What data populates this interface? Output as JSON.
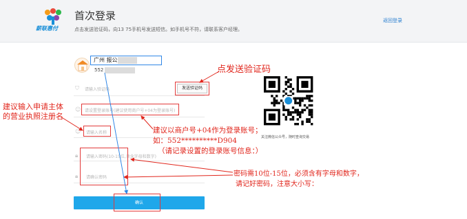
{
  "header": {
    "title": "首次登录",
    "subtitle": "点击发送验证码，向13        75手机号发送短信。如手机号不符，请联系客户经理。",
    "return_link": "返回登录",
    "logo_text": "薪联惠付"
  },
  "merchant": {
    "name": "广州                报公司1",
    "id": "552                D9"
  },
  "form": {
    "code_label": "请输入验证码",
    "send_code_button": "发送验证码",
    "account_label": "请设置登录账号(建议使用商户号+04为登录账号)",
    "name_label": "请输入名称",
    "password_label": "请输入密码(10-15位,须含字母和数字)",
    "confirm_label": "请确认密码",
    "submit_button": "确认"
  },
  "qr": {
    "caption": "关注微信公众号，随时查询交易"
  },
  "annotations": {
    "send_code": "点发送验证码",
    "name_line1": "建议输入申请主体",
    "name_line2": "的营业执照注册名",
    "account_line1": "建议以商户号+04作为登录账号；",
    "account_line2": "如：552**********D904",
    "account_line3": "（请记录设置的登录账号信息：）",
    "password_line1": "密码需10位-15位，必须含有字母和数字，",
    "password_line2": "请记好密码，注意大小写："
  },
  "colors": {
    "accent": "#1fa7ea",
    "annotation_red": "#e1261c",
    "merchant_box_blue": "#2f86e6"
  }
}
